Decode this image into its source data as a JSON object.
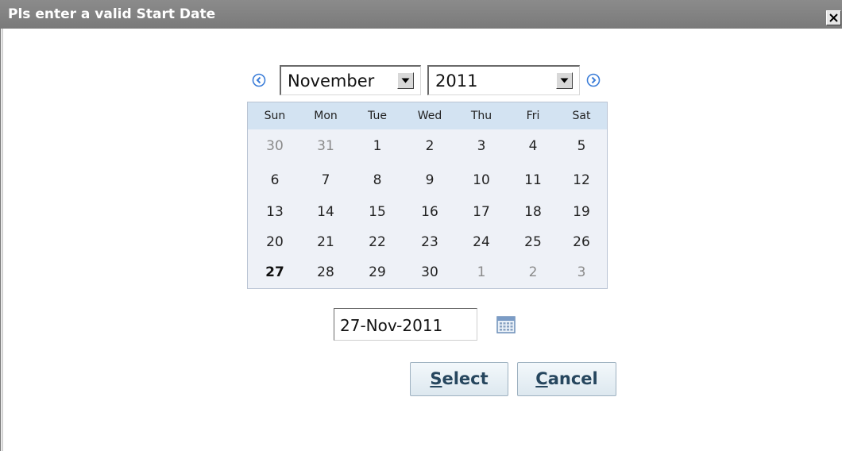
{
  "dialog": {
    "title": "Pls enter a valid Start Date"
  },
  "picker": {
    "month": "November",
    "year": "2011",
    "weekdays": [
      "Sun",
      "Mon",
      "Tue",
      "Wed",
      "Thu",
      "Fri",
      "Sat"
    ],
    "weeks": [
      [
        {
          "d": "30",
          "other": true
        },
        {
          "d": "31",
          "other": true
        },
        {
          "d": "1"
        },
        {
          "d": "2"
        },
        {
          "d": "3"
        },
        {
          "d": "4"
        },
        {
          "d": "5"
        }
      ],
      [
        {
          "d": "6"
        },
        {
          "d": "7"
        },
        {
          "d": "8"
        },
        {
          "d": "9"
        },
        {
          "d": "10"
        },
        {
          "d": "11"
        },
        {
          "d": "12"
        }
      ],
      [
        {
          "d": "13"
        },
        {
          "d": "14"
        },
        {
          "d": "15"
        },
        {
          "d": "16"
        },
        {
          "d": "17"
        },
        {
          "d": "18"
        },
        {
          "d": "19"
        }
      ],
      [
        {
          "d": "20"
        },
        {
          "d": "21"
        },
        {
          "d": "22"
        },
        {
          "d": "23"
        },
        {
          "d": "24"
        },
        {
          "d": "25"
        },
        {
          "d": "26"
        }
      ],
      [
        {
          "d": "27",
          "selected": true
        },
        {
          "d": "28"
        },
        {
          "d": "29"
        },
        {
          "d": "30"
        },
        {
          "d": "1",
          "other": true
        },
        {
          "d": "2",
          "other": true
        },
        {
          "d": "3",
          "other": true
        }
      ]
    ],
    "date_value": "27-Nov-2011"
  },
  "buttons": {
    "select_mnemonic": "S",
    "select_rest": "elect",
    "cancel_mnemonic": "C",
    "cancel_rest": "ancel"
  },
  "icons": {
    "close": "close-icon",
    "prev": "previous-month-icon",
    "next": "next-month-icon",
    "dropdown": "chevron-down-icon",
    "calendar": "calendar-icon"
  },
  "colors": {
    "titlebar": "#808080",
    "header_row": "#d3e3f2",
    "calendar_bg": "#eef1f7",
    "button_text": "#26465e",
    "nav_arrow": "#3b7dd8"
  }
}
